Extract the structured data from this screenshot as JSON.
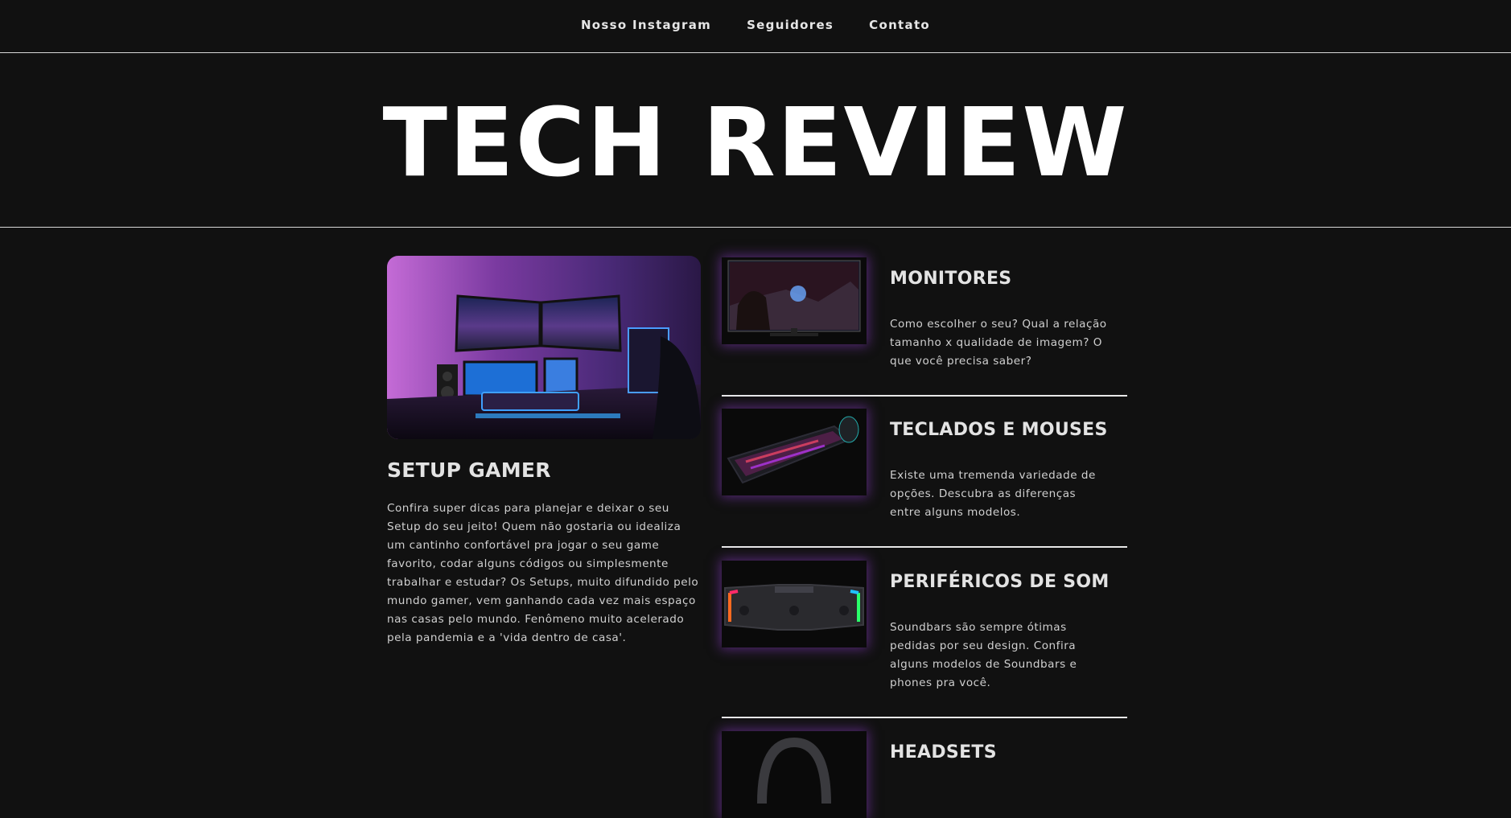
{
  "nav": {
    "items": [
      "Nosso Instagram",
      "Seguidores",
      "Contato"
    ]
  },
  "hero": {
    "title": "TECH REVIEW"
  },
  "feature": {
    "title": "SETUP GAMER",
    "text": "Confira super dicas para planejar e deixar o seu Setup do seu jeito! Quem não gostaria ou idealiza um cantinho confortável pra jogar o seu game favorito, codar alguns códigos ou simplesmente trabalhar e estudar? Os Setups, muito difundido pelo mundo gamer, vem ganhando cada vez mais espaço nas casas pelo mundo. Fenômeno muito acelerado pela pandemia e a 'vida dentro de casa'."
  },
  "articles": [
    {
      "title": "MONITORES",
      "text": "Como escolher o seu? Qual a relação tamanho x qualidade de imagem? O que você precisa saber?"
    },
    {
      "title": "TECLADOS E MOUSES",
      "text": "Existe uma tremenda variedade de opções. Descubra as diferenças entre alguns modelos."
    },
    {
      "title": "PERIFÉRICOS DE SOM",
      "text": "Soundbars são sempre ótimas pedidas por seu design. Confira alguns modelos de Soundbars e phones pra você."
    },
    {
      "title": "HEADSETS",
      "text": ""
    }
  ],
  "colors": {
    "background": "#111111",
    "accent_glow": "#8c3cc8",
    "text": "#dcdcdc",
    "heading": "#ffffff"
  }
}
